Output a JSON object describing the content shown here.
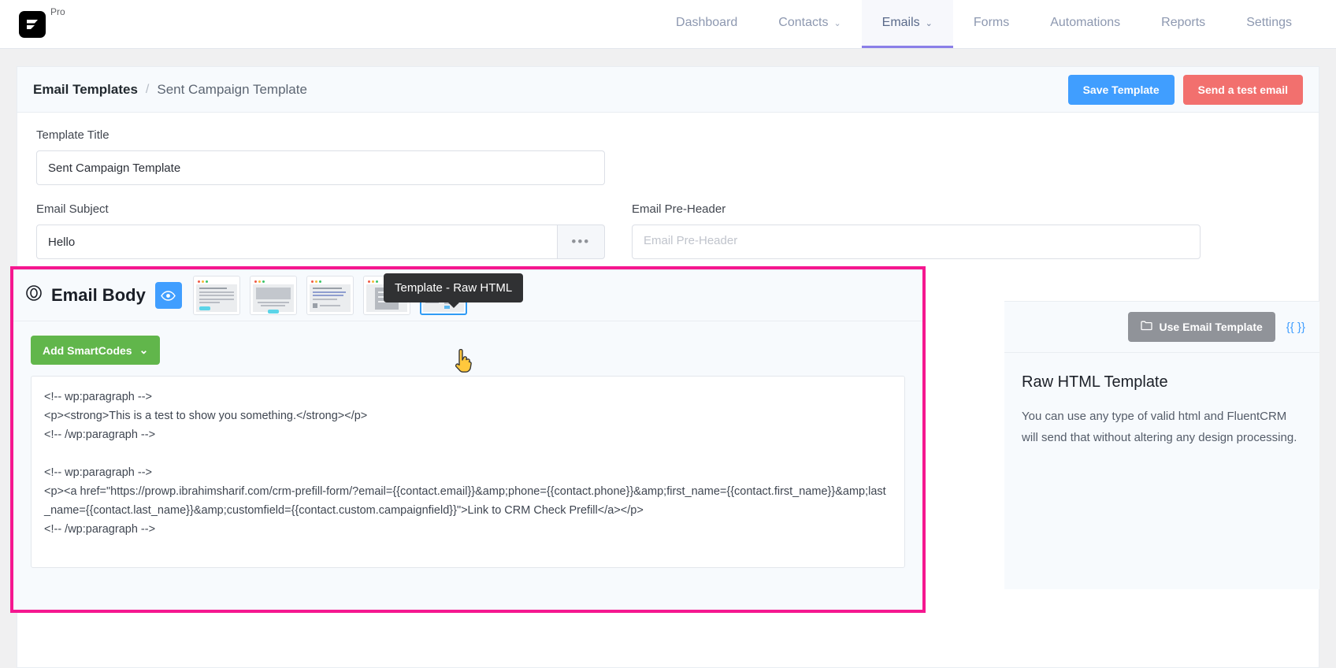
{
  "brand": {
    "pro_label": "Pro",
    "logo_icon": "fluentcrm-logo-icon"
  },
  "nav": {
    "items": [
      {
        "label": "Dashboard",
        "has_caret": false,
        "active": false
      },
      {
        "label": "Contacts",
        "has_caret": true,
        "active": false
      },
      {
        "label": "Emails",
        "has_caret": true,
        "active": true
      },
      {
        "label": "Forms",
        "has_caret": false,
        "active": false
      },
      {
        "label": "Automations",
        "has_caret": false,
        "active": false
      },
      {
        "label": "Reports",
        "has_caret": false,
        "active": false
      },
      {
        "label": "Settings",
        "has_caret": false,
        "active": false
      }
    ],
    "caret_glyph": "⌄"
  },
  "breadcrumb": {
    "root": "Email Templates",
    "separator": "/",
    "current": "Sent Campaign Template"
  },
  "header_actions": {
    "save_label": "Save Template",
    "test_label": "Send a test email"
  },
  "form": {
    "title_label": "Template Title",
    "title_value": "Sent Campaign Template",
    "subject_label": "Email Subject",
    "subject_value": "Hello",
    "subject_more_glyph": "•••",
    "preheader_label": "Email Pre-Header",
    "preheader_value": "",
    "preheader_placeholder": "Email Pre-Header"
  },
  "builder": {
    "heading": "Email Body",
    "preview_icon": "eye-icon",
    "tooltip": "Template - Raw HTML",
    "smartcodes_label": "Add SmartCodes",
    "smartcodes_caret": "⌄",
    "templates": [
      {
        "name": "template-classic",
        "selected": false
      },
      {
        "name": "template-image",
        "selected": false
      },
      {
        "name": "template-newsletter",
        "selected": false
      },
      {
        "name": "template-simple",
        "selected": false
      },
      {
        "name": "template-raw-html",
        "selected": true
      }
    ],
    "code": "<!-- wp:paragraph -->\n<p><strong>This is a test to show you something.</strong></p>\n<!-- /wp:paragraph -->\n\n<!-- wp:paragraph -->\n<p><a href=\"https://prowp.ibrahimsharif.com/crm-prefill-form/?email={{contact.email}}&amp;phone={{contact.phone}}&amp;first_name={{contact.first_name}}&amp;last_name={{contact.last_name}}&amp;customfield={{contact.custom.campaignfield}}\">Link to CRM Check Prefill</a></p>\n<!-- /wp:paragraph -->"
  },
  "side_panel": {
    "use_template_label": "Use Email Template",
    "folder_icon": "folder-icon",
    "smartcode_token": "{{ }}",
    "title": "Raw HTML Template",
    "description": "You can use any type of valid html and FluentCRM will send that without altering any design processing."
  },
  "colors": {
    "accent_blue": "#409eff",
    "danger_red": "#f2706e",
    "green": "#61b64b",
    "highlight_pink": "#f5178f",
    "nav_active_underline": "#8b7fe8"
  },
  "cursor": {
    "icon": "pointing-hand-cursor"
  }
}
